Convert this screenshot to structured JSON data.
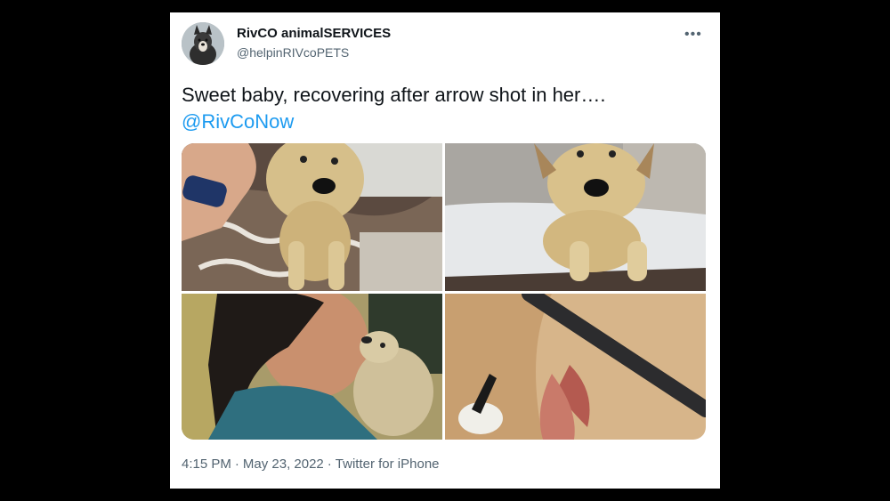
{
  "tweet": {
    "display_name": "RivCO animalSERVICES",
    "handle": "@helpinRIVcoPETS",
    "more_icon": "ellipsis-icon",
    "text": "Sweet baby, recovering after arrow shot in her….",
    "mention": "@RivCoNow",
    "time": "4:15 PM",
    "separator": "·",
    "date": "May 23, 2022",
    "source": "Twitter for iPhone"
  },
  "colors": {
    "background": "#000000",
    "card": "#ffffff",
    "text": "#0f1419",
    "secondary": "#536471",
    "link": "#1d9bf0"
  }
}
